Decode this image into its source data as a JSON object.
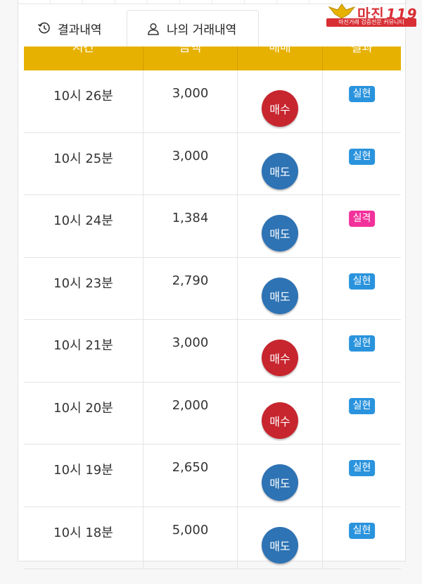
{
  "tabs": [
    {
      "label": "결과내역",
      "icon": "history-icon"
    },
    {
      "label": "나의 거래내역",
      "icon": "user-icon"
    }
  ],
  "logo": {
    "word": "마진",
    "num": "119",
    "subtitle": "마진거래 검증전문 커뮤니티"
  },
  "table": {
    "headers": [
      "시간",
      "금액",
      "매매",
      "결과"
    ],
    "rows": [
      {
        "time": "10시 26분",
        "amount": "3,000",
        "trade": "매수",
        "result": "실현"
      },
      {
        "time": "10시 25분",
        "amount": "3,000",
        "trade": "매도",
        "result": "실현"
      },
      {
        "time": "10시 24분",
        "amount": "1,384",
        "trade": "매도",
        "result": "실격"
      },
      {
        "time": "10시 23분",
        "amount": "2,790",
        "trade": "매도",
        "result": "실현"
      },
      {
        "time": "10시 21분",
        "amount": "3,000",
        "trade": "매수",
        "result": "실현"
      },
      {
        "time": "10시 20분",
        "amount": "2,000",
        "trade": "매수",
        "result": "실현"
      },
      {
        "time": "10시 19분",
        "amount": "2,650",
        "trade": "매도",
        "result": "실현"
      },
      {
        "time": "10시 18분",
        "amount": "5,000",
        "trade": "매도",
        "result": "실현"
      }
    ]
  },
  "colors": {
    "header": "#e6b100",
    "buy": "#c7262f",
    "sell": "#2e73b4",
    "success": "#2a93dd",
    "fail": "#f3319a"
  }
}
